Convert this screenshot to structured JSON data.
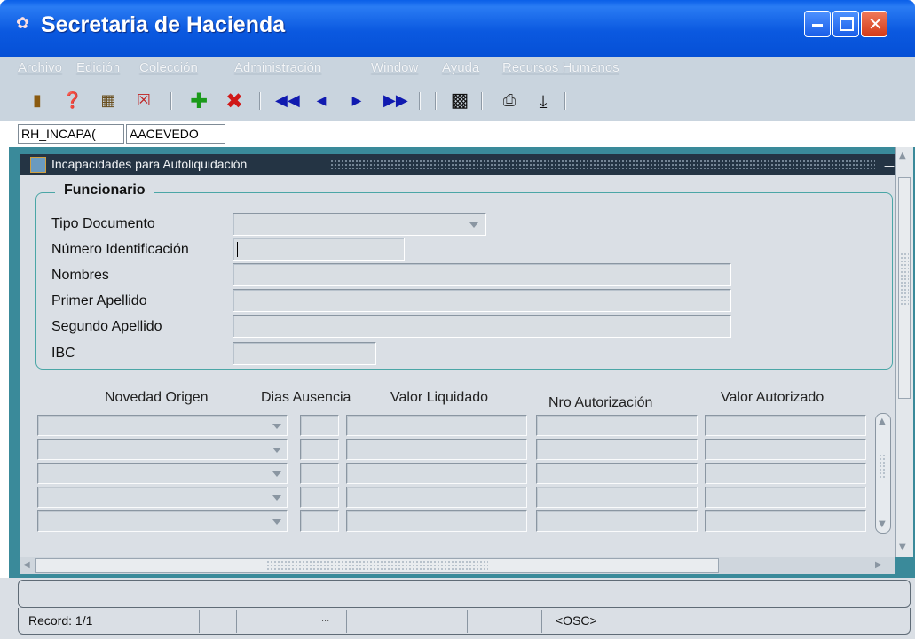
{
  "window": {
    "title": "Secretaria de Hacienda",
    "icon": "app-icon"
  },
  "menu": [
    "Archivo",
    "Edición",
    "Colección",
    "Administración",
    "Window",
    "Ayuda",
    "Recursos Humanos"
  ],
  "toolbar": {
    "icons": [
      "exit-icon",
      "help-icon",
      "open-icon",
      "close-form-icon",
      "insert-record-icon",
      "delete-record-icon",
      "first-record-icon",
      "previous-record-icon",
      "next-record-icon",
      "last-record-icon",
      "save-icon",
      "print-icon",
      "download-icon"
    ]
  },
  "context": {
    "form_code": "RH_INCAPA(",
    "user": "AACEVEDO"
  },
  "form": {
    "title": "Incapacidades para Autoliquidación",
    "group_title": "Funcionario",
    "labels": {
      "tipo_documento": "Tipo Documento",
      "numero_identificacion": "Número Identificación",
      "nombres": "Nombres",
      "primer_apellido": "Primer Apellido",
      "segundo_apellido": "Segundo Apellido",
      "ibc": "IBC"
    },
    "values": {
      "tipo_documento": "",
      "numero_identificacion": "",
      "nombres": "",
      "primer_apellido": "",
      "segundo_apellido": "",
      "ibc": ""
    }
  },
  "grid": {
    "columns": [
      "Novedad Origen",
      "Dias Ausencia",
      "Valor Liquidado",
      "Nro Autorización",
      "Valor Autorizado"
    ],
    "row_count": 5
  },
  "status": {
    "record": "Record: 1/1",
    "ellipsis": "...",
    "mode": "<OSC>"
  },
  "colors": {
    "titlebar": "#0b59e0",
    "menubar": "#c9d4de",
    "mdi_background": "#3a8a9a",
    "form_background": "#dadfe5",
    "group_border": "#4aa6a6"
  }
}
